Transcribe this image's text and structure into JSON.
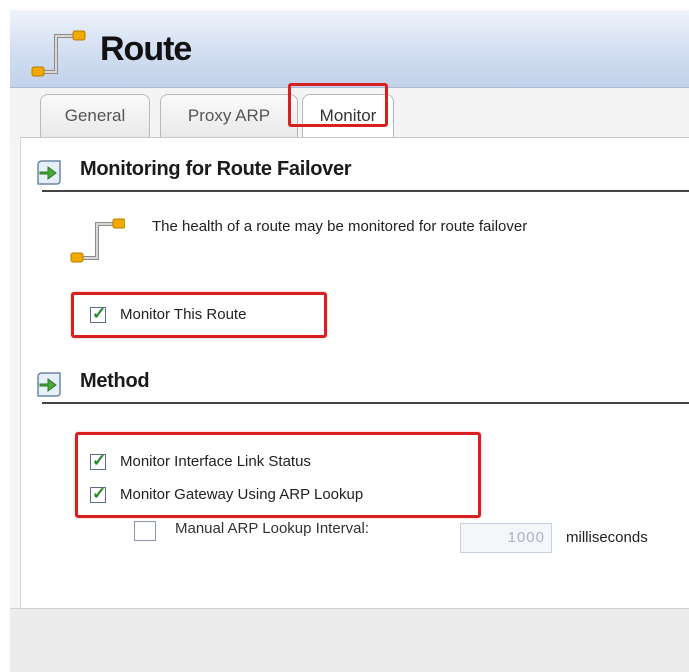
{
  "window": {
    "title": "Route"
  },
  "tabs": [
    {
      "label": "General"
    },
    {
      "label": "Proxy ARP"
    },
    {
      "label": "Monitor"
    }
  ],
  "sections": {
    "failover": {
      "title": "Monitoring for Route Failover",
      "description": "The health of a route may be monitored for route failover",
      "monitor_route": {
        "label": "Monitor This Route",
        "checked": true
      }
    },
    "method": {
      "title": "Method",
      "link_status": {
        "label": "Monitor Interface Link Status",
        "checked": true
      },
      "arp_lookup": {
        "label": "Monitor Gateway Using ARP Lookup",
        "checked": true
      },
      "manual_interval": {
        "label": "Manual ARP Lookup Interval:",
        "checked": false,
        "value": "1000",
        "unit": "milliseconds"
      }
    }
  },
  "icons": {
    "title": "route-icon",
    "info": "route-icon",
    "section": "arrow-right-icon"
  },
  "colors": {
    "highlight": "#d82020",
    "check": "#2a8a2a",
    "title_bar": "#d2def1"
  }
}
